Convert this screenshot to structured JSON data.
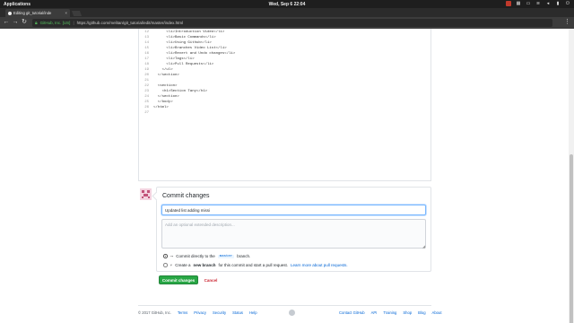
{
  "os": {
    "apps_label": "Applications",
    "clock": "Wed, Sep 6  22:04"
  },
  "browser": {
    "tab_title": "Editing git_tutorial/inde",
    "site_identity": "GitHub, Inc. [US]",
    "url": "https://github.com/melitan/git_tutorial/edit/master/index.html"
  },
  "code": {
    "lines": [
      {
        "num": "12",
        "text": "      <li>Introduction Video</li>"
      },
      {
        "num": "13",
        "text": "      <li>Basic Commands</li>"
      },
      {
        "num": "14",
        "text": "      <li>Using Github</li>"
      },
      {
        "num": "15",
        "text": "      <li>Branches Video List</li>"
      },
      {
        "num": "16",
        "text": "      <li>Revert and Undo changes</li>"
      },
      {
        "num": "17",
        "text": "      <li>Tags</li>"
      },
      {
        "num": "18",
        "text": "      <li>Pull Requests</li>"
      },
      {
        "num": "19",
        "text": "    </ul>"
      },
      {
        "num": "20",
        "text": "  </section>"
      },
      {
        "num": "21",
        "text": ""
      },
      {
        "num": "22",
        "text": "  <section>"
      },
      {
        "num": "23",
        "text": "    <h1>Section Tany</h1>"
      },
      {
        "num": "24",
        "text": "  </section>"
      },
      {
        "num": "25",
        "text": "  </body>"
      },
      {
        "num": "26",
        "text": "</html>"
      },
      {
        "num": "27",
        "text": ""
      }
    ]
  },
  "commit": {
    "title": "Commit changes",
    "summary_value": "Updated list adding missi",
    "description_placeholder": "Add an optional extended description...",
    "option1_prefix": "Commit directly to the",
    "option1_branch": "master",
    "option1_suffix": "branch.",
    "option2_create": "Create a",
    "option2_bold": "new branch",
    "option2_rest": "for this commit and start a pull request.",
    "option2_link": "Learn more about pull requests.",
    "commit_button": "Commit changes",
    "cancel_button": "Cancel"
  },
  "footer": {
    "copyright": "© 2017 GitHub, Inc.",
    "left_links": [
      "Terms",
      "Privacy",
      "Security",
      "Status",
      "Help"
    ],
    "right_links": [
      "Contact GitHub",
      "API",
      "Training",
      "Shop",
      "Blog",
      "About"
    ]
  },
  "colors": {
    "commit_green": "#28a745",
    "link_blue": "#0366d6",
    "cancel_red": "#cb2431"
  }
}
